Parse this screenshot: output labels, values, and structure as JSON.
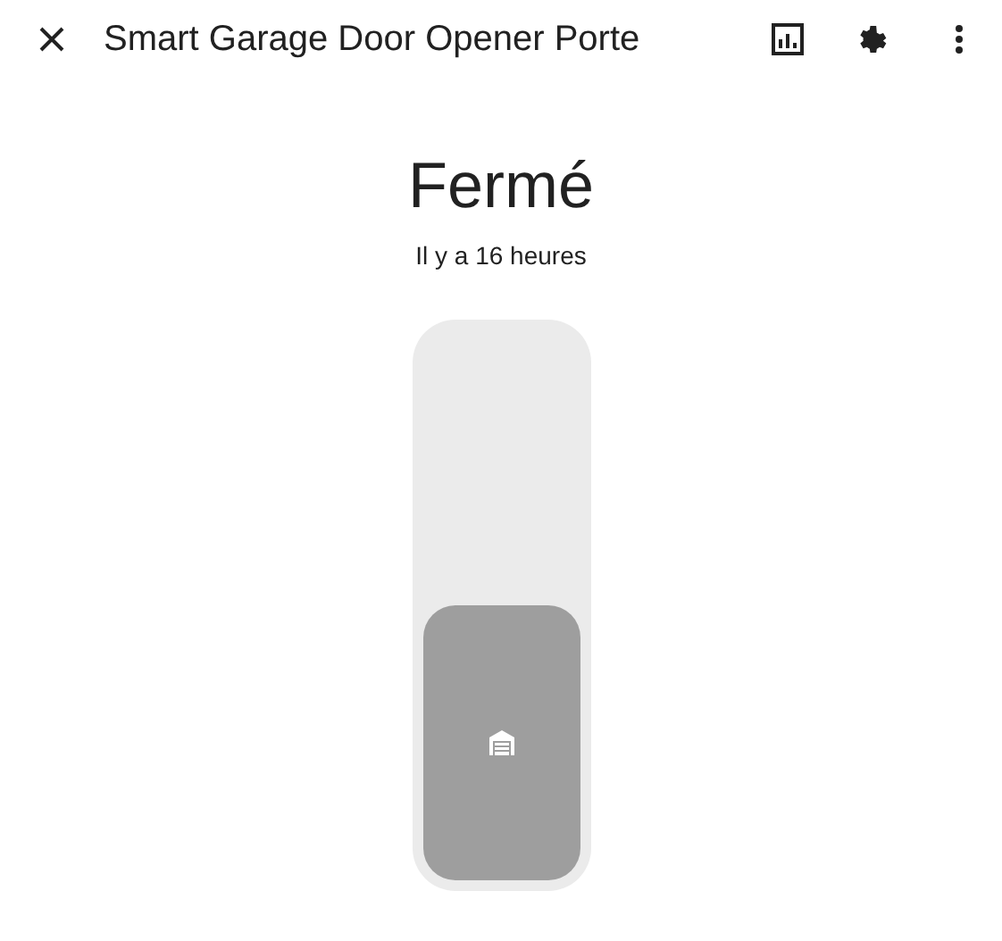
{
  "header": {
    "title": "Smart Garage Door Opener Porte"
  },
  "state": {
    "label": "Fermé",
    "last_changed": "Il y a 16 heures"
  },
  "control": {
    "level": 0.5
  }
}
